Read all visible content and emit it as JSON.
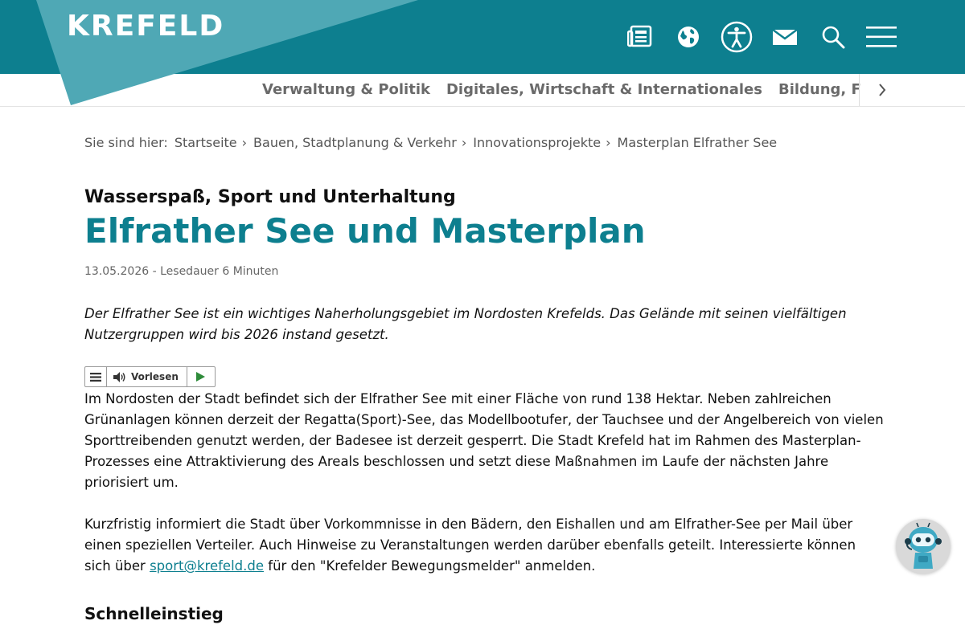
{
  "header": {
    "logo": "KREFELD",
    "icons": [
      "newspaper-icon",
      "globe-icon",
      "accessibility-icon",
      "mail-icon",
      "search-icon",
      "menu-icon"
    ]
  },
  "nav": {
    "items": [
      {
        "label": "Verwaltung & Politik"
      },
      {
        "label": "Digitales, Wirtschaft & Internationales"
      },
      {
        "label": "Bildung, Familie & Senioren"
      }
    ],
    "next_icon": "chevron-right-icon"
  },
  "breadcrumb": {
    "label": "Sie sind hier:",
    "items": [
      "Startseite",
      "Bauen, Stadtplanung & Verkehr",
      "Innovationsprojekte",
      "Masterplan Elfrather See"
    ],
    "separator": "›"
  },
  "article": {
    "kicker": "Wasserspaß, Sport und Unterhaltung",
    "title": "Elfrather See und Masterplan",
    "meta": "13.05.2026 - Lesedauer 6 Minuten",
    "lead": "Der Elfrather See ist ein wichtiges Naherholungsgebiet im Nordosten Krefelds. Das Gelände mit seinen vielfältigen Nutzergruppen wird bis 2026 instand gesetzt.",
    "readspeaker": {
      "listen_label": "Vorlesen"
    },
    "paragraph1": "Im Nordosten der Stadt befindet sich der Elfrather See mit einer Fläche von rund 138 Hektar. Neben zahlreichen Grünanlagen können derzeit der Regatta(Sport)-See, das Modellbootufer, der Tauchsee und der Angelbereich von vielen Sporttreibenden genutzt werden, der Badesee ist derzeit gesperrt. Die Stadt Krefeld hat im Rahmen des Masterplan-Prozesses eine Attraktivierung des Areals beschlossen und setzt diese Maßnahmen im Laufe der nächsten Jahre priorisiert um.",
    "paragraph2_before": "Kurzfristig informiert die Stadt über Vorkommnisse in den Bädern, den Eishallen und am Elfrather-See per Mail über einen speziellen Verteiler. Auch Hinweise zu Veranstaltungen werden darüber ebenfalls geteilt. Interessierte können sich über ",
    "paragraph2_link": "sport@krefeld.de",
    "paragraph2_after": " für den \"Krefelder Bewegungsmelder\" anmelden.",
    "section_heading": "Schnelleinstieg"
  },
  "colors": {
    "brand": "#0d7f8f",
    "brand_light": "#4fa8b5",
    "nav_text": "#6a6a6a",
    "link": "#0d7f8f"
  },
  "chatbot": {
    "icon": "chatbot-robot-icon"
  }
}
